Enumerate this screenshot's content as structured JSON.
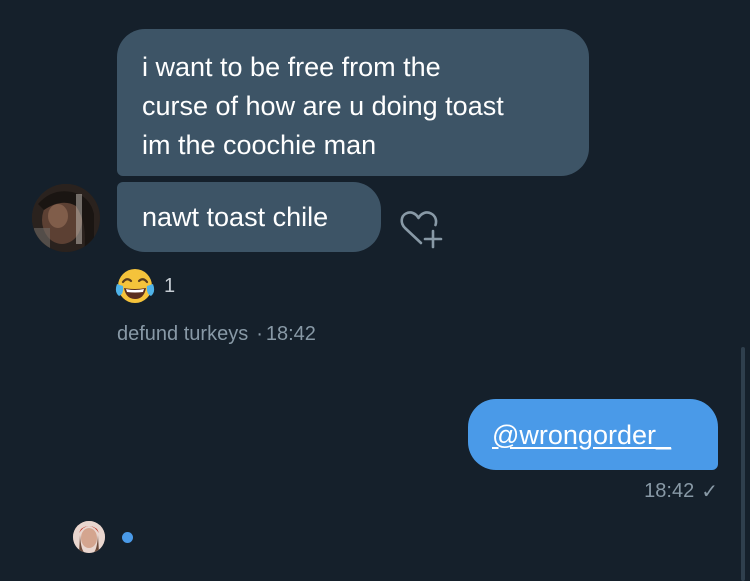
{
  "conversation": {
    "received_messages": [
      {
        "lines": [
          "i want to be free from the",
          "curse of how are u doing toast",
          "im the coochie man"
        ]
      },
      {
        "text": "nawt toast chile"
      }
    ],
    "reaction": {
      "emoji": "face-with-tears-of-joy",
      "count": "1"
    },
    "received_meta": {
      "sender": "defund turkeys",
      "separator": "·",
      "time": "18:42"
    },
    "sent_message": {
      "mention": "@wrongorder_"
    },
    "sent_meta": {
      "time": "18:42",
      "status_icon": "check-icon",
      "status_glyph": "✓"
    }
  },
  "colors": {
    "background": "#15202b",
    "received_bubble": "#3d5466",
    "sent_bubble": "#4a9ae8",
    "meta_text": "#8899a6",
    "typing_dot": "#4a9ae8"
  }
}
